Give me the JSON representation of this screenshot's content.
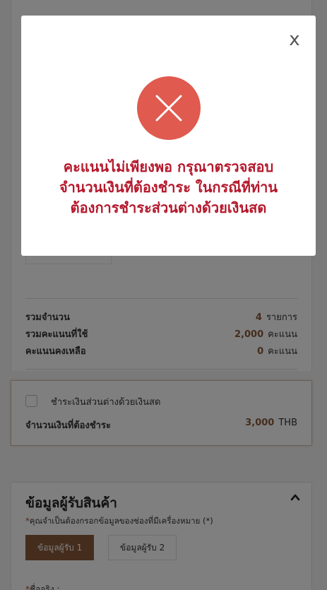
{
  "summary": {
    "total_items_label": "รวมจำนวน",
    "total_items_value": "4",
    "total_items_unit": "รายการ",
    "points_used_label": "รวมคะแนนที่ใช้",
    "points_used_value": "2,000",
    "points_used_unit": "คะแนน",
    "points_left_label": "คะแนนคงเหลือ",
    "points_left_value": "0",
    "points_left_unit": "คะแนน"
  },
  "cash": {
    "checkbox_label": "ชำระเงินส่วนต่างด้วยเงินสด",
    "pay_label": "จำนวนเงินที่ต้องชำระ",
    "pay_value": "3,000",
    "pay_currency": "THB"
  },
  "receiver": {
    "title": "ข้อมูลผู้รับสินค้า",
    "note_star": "*",
    "note": "คุณจำเป็นต้องกรอกข้อมูลของช่องที่มีเครื่องหมาย (*)",
    "tab1": "ข้อมูลผู้รับ 1",
    "tab2": "ข้อมูลผู้รับ 2",
    "name_star": "*",
    "name_label": "ชื่อจริง :"
  },
  "modal": {
    "close": "x",
    "line1": "คะแนนไม่เพียงพอ กรุณาตรวจสอบ",
    "line2": "จำนวนเงินที่ต้องชำระ ในกรณีที่ท่าน",
    "line3": "ต้องการชำระส่วนต่างด้วยเงินสด"
  },
  "colors": {
    "accent": "#8a5a3a",
    "error_red": "#b5172b",
    "error_icon": "#e05a4f"
  }
}
